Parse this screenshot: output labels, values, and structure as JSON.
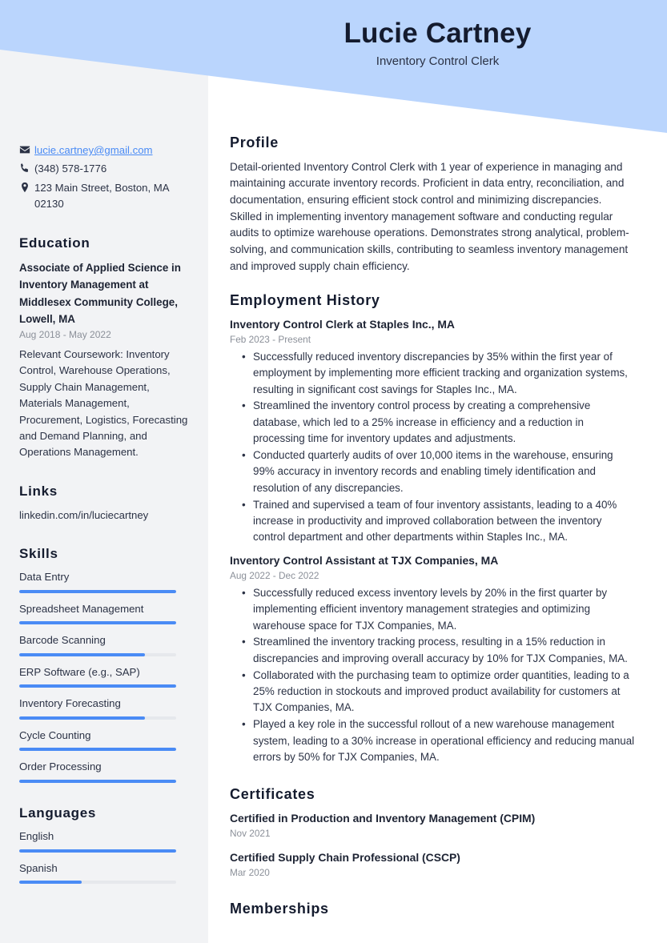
{
  "theme": {
    "banner_color": "#bad5fd",
    "sidebar_color": "#f2f3f5",
    "accent_color": "#4a8bf5",
    "heading_color": "#141b2e",
    "text_color": "#2b3245",
    "muted_color": "#8b9099"
  },
  "header": {
    "name": "Lucie Cartney",
    "job_title": "Inventory Control Clerk"
  },
  "sidebar": {
    "contact": [
      {
        "icon": "envelope-icon",
        "value": "lucie.cartney@gmail.com",
        "is_link": true
      },
      {
        "icon": "phone-icon",
        "value": "(348) 578-1776",
        "is_link": false
      },
      {
        "icon": "map-pin-icon",
        "value": "123 Main Street, Boston, MA 02130",
        "is_link": false
      }
    ],
    "education": {
      "heading": "Education",
      "degree": "Associate of Applied Science in Inventory Management at Middlesex Community College, Lowell, MA",
      "date": "Aug 2018 - May 2022",
      "description": "Relevant Coursework: Inventory Control, Warehouse Operations, Supply Chain Management, Materials Management, Procurement, Logistics, Forecasting and Demand Planning, and Operations Management."
    },
    "links": {
      "heading": "Links",
      "items": [
        {
          "label": "linkedin.com/in/luciecartney"
        }
      ]
    },
    "skills": {
      "heading": "Skills",
      "items": [
        {
          "label": "Data Entry",
          "level": 100
        },
        {
          "label": "Spreadsheet Management",
          "level": 100
        },
        {
          "label": "Barcode Scanning",
          "level": 80
        },
        {
          "label": "ERP Software (e.g., SAP)",
          "level": 100
        },
        {
          "label": "Inventory Forecasting",
          "level": 80
        },
        {
          "label": "Cycle Counting",
          "level": 100
        },
        {
          "label": "Order Processing",
          "level": 100
        }
      ]
    },
    "languages": {
      "heading": "Languages",
      "items": [
        {
          "label": "English",
          "level": 100
        },
        {
          "label": "Spanish",
          "level": 40
        }
      ]
    }
  },
  "main": {
    "profile": {
      "heading": "Profile",
      "text": "Detail-oriented Inventory Control Clerk with 1 year of experience in managing and maintaining accurate inventory records. Proficient in data entry, reconciliation, and documentation, ensuring efficient stock control and minimizing discrepancies. Skilled in implementing inventory management software and conducting regular audits to optimize warehouse operations. Demonstrates strong analytical, problem-solving, and communication skills, contributing to seamless inventory management and improved supply chain efficiency."
    },
    "employment": {
      "heading": "Employment History",
      "jobs": [
        {
          "title": "Inventory Control Clerk at Staples Inc., MA",
          "date": "Feb 2023 - Present",
          "bullets": [
            "Successfully reduced inventory discrepancies by 35% within the first year of employment by implementing more efficient tracking and organization systems, resulting in significant cost savings for Staples Inc., MA.",
            "Streamlined the inventory control process by creating a comprehensive database, which led to a 25% increase in efficiency and a reduction in processing time for inventory updates and adjustments.",
            "Conducted quarterly audits of over 10,000 items in the warehouse, ensuring 99% accuracy in inventory records and enabling timely identification and resolution of any discrepancies.",
            "Trained and supervised a team of four inventory assistants, leading to a 40% increase in productivity and improved collaboration between the inventory control department and other departments within Staples Inc., MA."
          ]
        },
        {
          "title": "Inventory Control Assistant at TJX Companies, MA",
          "date": "Aug 2022 - Dec 2022",
          "bullets": [
            "Successfully reduced excess inventory levels by 20% in the first quarter by implementing efficient inventory management strategies and optimizing warehouse space for TJX Companies, MA.",
            "Streamlined the inventory tracking process, resulting in a 15% reduction in discrepancies and improving overall accuracy by 10% for TJX Companies, MA.",
            "Collaborated with the purchasing team to optimize order quantities, leading to a 25% reduction in stockouts and improved product availability for customers at TJX Companies, MA.",
            "Played a key role in the successful rollout of a new warehouse management system, leading to a 30% increase in operational efficiency and reducing manual errors by 50% for TJX Companies, MA."
          ]
        }
      ]
    },
    "certificates": {
      "heading": "Certificates",
      "items": [
        {
          "title": "Certified in Production and Inventory Management (CPIM)",
          "date": "Nov 2021"
        },
        {
          "title": "Certified Supply Chain Professional (CSCP)",
          "date": "Mar 2020"
        }
      ]
    },
    "memberships": {
      "heading": "Memberships"
    }
  }
}
